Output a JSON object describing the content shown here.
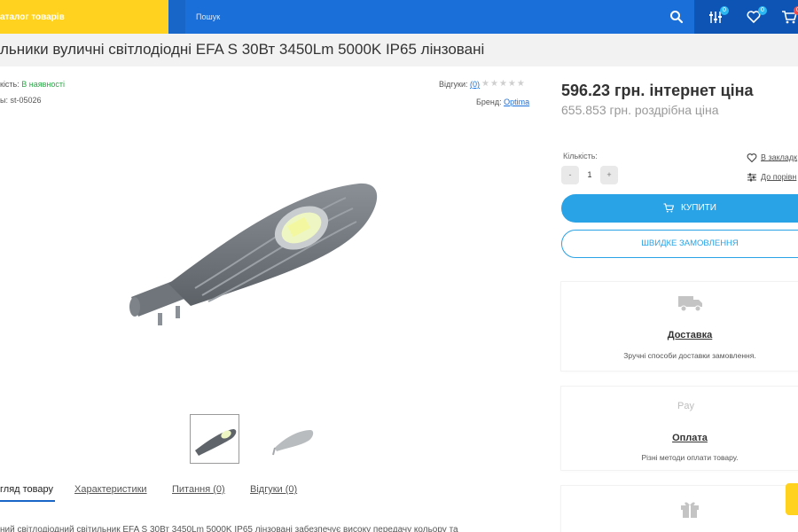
{
  "header": {
    "catalog_label": "аталог товарів",
    "search_placeholder": "Пошук",
    "compare_count": "0",
    "wishlist_count": "0",
    "cart_count": "0",
    "colors": {
      "brand_blue": "#1966c9",
      "catalog_yellow": "#ffd21f",
      "accent_blue": "#2aa3e6"
    }
  },
  "product": {
    "title": "льники вуличні світлодіодні EFA S 30Вт 3450Lm 5000K IP65 лінзовані",
    "availability_label": "кість:",
    "availability_value": "В наявності",
    "sku_label": "ы:",
    "sku_value": "st-05026",
    "reviews_label": "Відгуки:",
    "reviews_count": "(0)",
    "rating": 0,
    "brand_label": "Бренд:",
    "brand_value": "Optima"
  },
  "tabs": [
    {
      "label": "гляд товару"
    },
    {
      "label": "Характеристики"
    },
    {
      "label": "Питання (0)"
    },
    {
      "label": "Відгуки (0)"
    }
  ],
  "description": "ний світлодіодний світильник EFA S 30Вт 3450Lm 5000K IP65 лінзовані забезпечує високу передачу кольору та",
  "pricing": {
    "internet_price": "596.23 грн. інтернет ціна",
    "retail_price": "655.853 грн. роздрібна ціна"
  },
  "purchase": {
    "quantity_label": "Кількість:",
    "quantity_minus": "-",
    "quantity_value": "1",
    "quantity_plus": "+",
    "wishlist_link": "В закладк",
    "compare_link": "До порівн",
    "buy_label": "КУПИТИ",
    "quick_order_label": "ШВИДКЕ ЗАМОВЛЕННЯ"
  },
  "info_cards": [
    {
      "title": "Доставка",
      "subtitle": "Зручні способи доставки замовлення.",
      "icon": "truck-icon"
    },
    {
      "title": "Оплата",
      "subtitle": "Різні методи оплати товару.",
      "icon": "apple-pay-icon",
      "icon_text": "Pay"
    },
    {
      "title": "",
      "subtitle": "",
      "icon": "gift-icon"
    }
  ]
}
